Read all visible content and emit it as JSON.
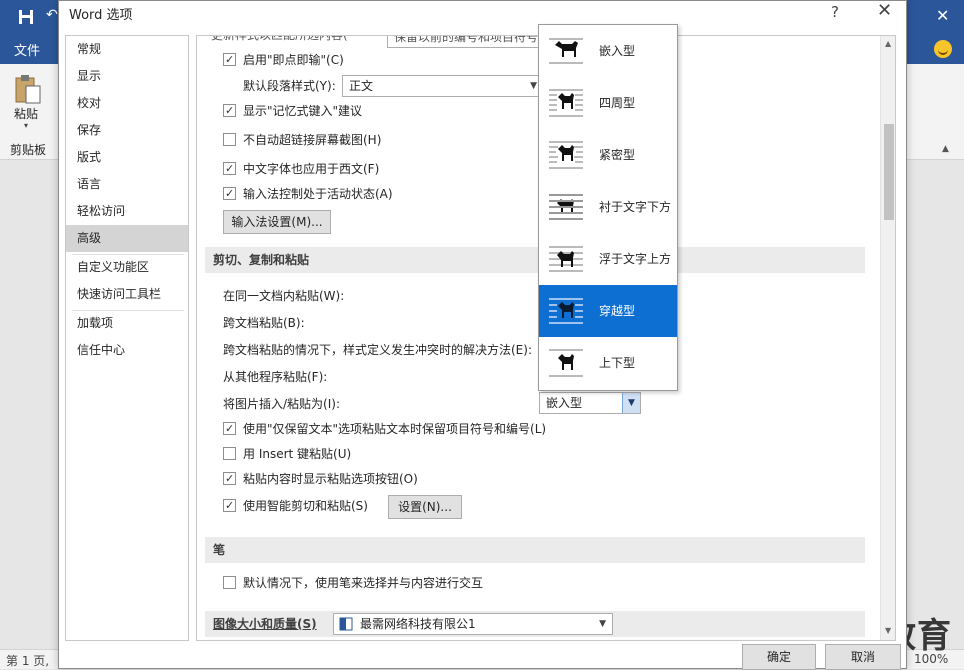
{
  "word": {
    "file_tab": "文件",
    "paste_label": "粘贴",
    "clipboard_label": "剪贴板",
    "status_left": "第 1 页,",
    "zoom": "100%",
    "watermark": "最需教育"
  },
  "dialog": {
    "title": "Word 选项",
    "help": "?",
    "close": "✕",
    "ok": "确定",
    "cancel": "取消"
  },
  "nav": {
    "items": [
      {
        "label": "常规",
        "active": false
      },
      {
        "label": "显示",
        "active": false
      },
      {
        "label": "校对",
        "active": false
      },
      {
        "label": "保存",
        "active": false
      },
      {
        "label": "版式",
        "active": false
      },
      {
        "label": "语言",
        "active": false
      },
      {
        "label": "轻松访问",
        "active": false
      },
      {
        "label": "高级",
        "active": true
      },
      {
        "label": "自定义功能区",
        "active": false
      },
      {
        "label": "快速访问工具栏",
        "active": false
      },
      {
        "label": "加载项",
        "active": false
      },
      {
        "label": "信任中心",
        "active": false
      }
    ]
  },
  "content": {
    "top_cut_text": "更新样式以匹配所选内容(",
    "top_cut_dropdown": "保留以前的编号和项目符号",
    "click_type": {
      "label": "启用\"即点即输\"(C)",
      "checked": true
    },
    "default_para_label": "默认段落样式(Y):",
    "default_para_value": "正文",
    "autocomplete": {
      "label": "显示\"记忆式键入\"建议",
      "checked": true
    },
    "no_hyperlink_capture": {
      "label": "不自动超链接屏幕截图(H)",
      "checked": false
    },
    "cjk_font_western": {
      "label": "中文字体也应用于西文(F)",
      "checked": true
    },
    "ime_active": {
      "label": "输入法控制处于活动状态(A)",
      "checked": true
    },
    "ime_settings_button": "输入法设置(M)...",
    "section_cut_copy_paste": "剪切、复制和粘贴",
    "paste_same_doc": "在同一文档内粘贴(W):",
    "paste_cross_doc": "跨文档粘贴(B):",
    "paste_cross_doc_conflict": "跨文档粘贴的情况下，样式定义发生冲突时的解决方法(E):",
    "paste_other_programs": "从其他程序粘贴(F):",
    "insert_picture_as_label": "将图片插入/粘贴为(I):",
    "insert_picture_as_value": "嵌入型",
    "keep_bullets": {
      "label": "使用\"仅保留文本\"选项粘贴文本时保留项目符号和编号(L)",
      "checked": true
    },
    "insert_key_paste": {
      "label": "用 Insert 键粘贴(U)",
      "checked": false
    },
    "show_paste_options": {
      "label": "粘贴内容时显示粘贴选项按钮(O)",
      "checked": true
    },
    "smart_cut_paste": {
      "label": "使用智能剪切和粘贴(S)",
      "checked": true
    },
    "settings_button": "设置(N)...",
    "section_pen": "笔",
    "pen_select": {
      "label": "默认情况下，使用笔来选择并与内容进行交互",
      "checked": false
    },
    "image_size_quality_label": "图像大小和质量(S)",
    "image_size_quality_value": "最需网络科技有限公1"
  },
  "wrap_popup": {
    "selected_index": 5,
    "items": [
      {
        "label": "嵌入型",
        "icon": "inline-wrap-icon"
      },
      {
        "label": "四周型",
        "icon": "square-wrap-icon"
      },
      {
        "label": "紧密型",
        "icon": "tight-wrap-icon"
      },
      {
        "label": "衬于文字下方",
        "icon": "behind-text-icon"
      },
      {
        "label": "浮于文字上方",
        "icon": "in-front-of-text-icon"
      },
      {
        "label": "穿越型",
        "icon": "through-wrap-icon"
      },
      {
        "label": "上下型",
        "icon": "top-bottom-wrap-icon"
      }
    ]
  },
  "colors": {
    "ribbon_blue": "#2b579a",
    "selection_blue": "#0d6fd1",
    "nav_active": "#d4d4d4"
  }
}
